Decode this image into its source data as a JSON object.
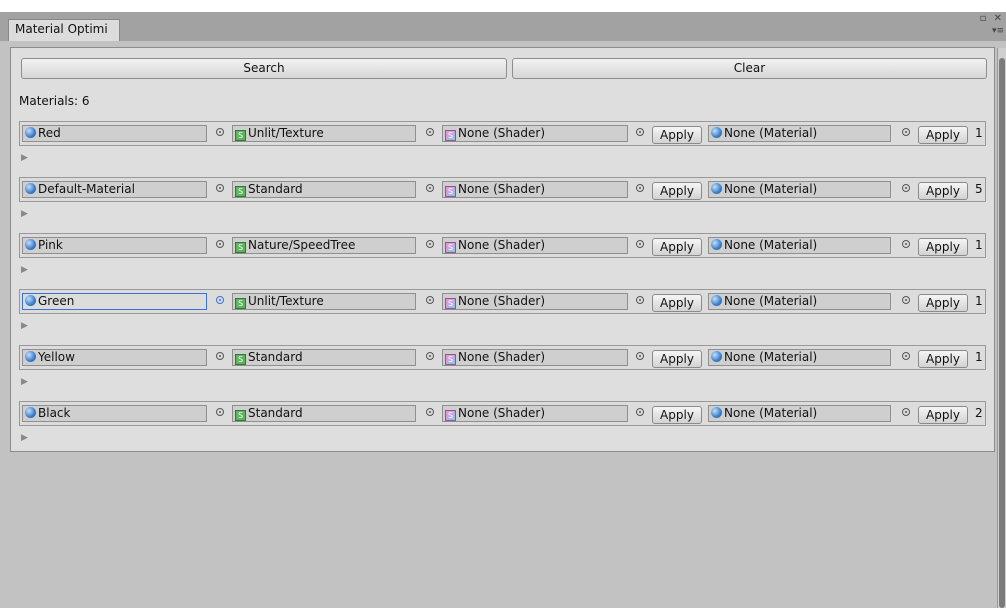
{
  "window": {
    "tab_title": "Material Optimi",
    "controls": "▫ ✕",
    "menu": "▾≡"
  },
  "toolbar": {
    "search_label": "Search",
    "clear_label": "Clear"
  },
  "materials_count_label": "Materials: 6",
  "columns": {
    "apply_label": "Apply"
  },
  "rows": [
    {
      "material": "Red",
      "shader": "Unlit/Texture",
      "replace_shader": "None (Shader)",
      "replace_material": "None (Material)",
      "count": "1"
    },
    {
      "material": "Default-Material",
      "shader": "Standard",
      "replace_shader": "None (Shader)",
      "replace_material": "None (Material)",
      "count": "5"
    },
    {
      "material": "Pink",
      "shader": "Nature/SpeedTree",
      "replace_shader": "None (Shader)",
      "replace_material": "None (Material)",
      "count": "1"
    },
    {
      "material": "Green",
      "shader": "Unlit/Texture",
      "replace_shader": "None (Shader)",
      "replace_material": "None (Material)",
      "count": "1"
    },
    {
      "material": "Yellow",
      "shader": "Standard",
      "replace_shader": "None (Shader)",
      "replace_material": "None (Material)",
      "count": "1"
    },
    {
      "material": "Black",
      "shader": "Standard",
      "replace_shader": "None (Shader)",
      "replace_material": "None (Material)",
      "count": "2"
    }
  ],
  "icons": {
    "material": "material-sphere-icon",
    "shader": "shader-icon",
    "picker": "object-picker-icon",
    "foldout": "foldout-arrow-icon"
  },
  "colors": {
    "focus_blue": "#3a72d8",
    "panel_bg": "#dedede"
  }
}
